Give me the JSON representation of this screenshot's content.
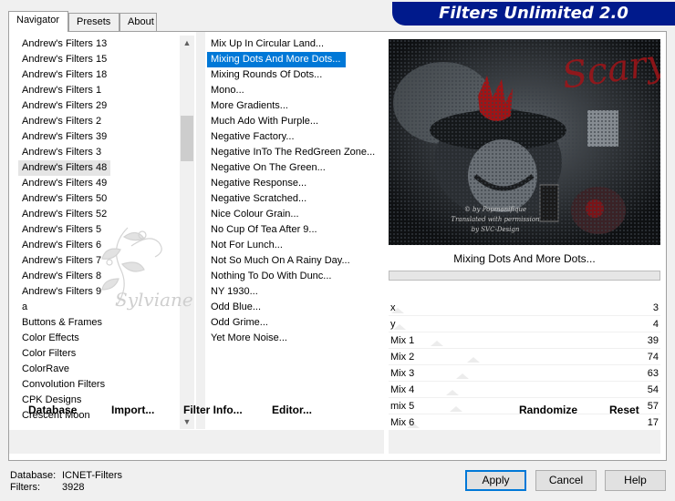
{
  "tabs": [
    "Navigator",
    "Presets",
    "About"
  ],
  "app_title": "Filters Unlimited 2.0",
  "categories": {
    "items": [
      "Andrew's Filters 13",
      "Andrew's Filters 15",
      "Andrew's Filters 18",
      "Andrew's Filters 1",
      "Andrew's Filters 29",
      "Andrew's Filters 2",
      "Andrew's Filters 39",
      "Andrew's Filters 3",
      "Andrew's Filters 48",
      "Andrew's Filters 49",
      "Andrew's Filters 50",
      "Andrew's Filters 52",
      "Andrew's Filters 5",
      "Andrew's Filters 6",
      "Andrew's Filters 7",
      "Andrew's Filters 8",
      "Andrew's Filters 9",
      "a",
      "Buttons & Frames",
      "Color Effects",
      "Color Filters",
      "ColorRave",
      "Convolution Filters",
      "CPK Designs",
      "Crescent Moon"
    ],
    "selected": "Andrew's Filters 48"
  },
  "filters": {
    "items": [
      "Mix Up In Circular Land...",
      "Mixing Dots And More Dots...",
      "Mixing Rounds Of Dots...",
      "Mono...",
      "More Gradients...",
      "Much Ado With Purple...",
      "Negative Factory...",
      "Negative InTo The RedGreen Zone...",
      "Negative On The Green...",
      "Negative Response...",
      "Negative Scratched...",
      "Nice Colour Grain...",
      "No Cup Of Tea After 9...",
      "Not For Lunch...",
      "Not So Much On A Rainy Day...",
      "Nothing To Do With Dunc...",
      "NY 1930...",
      "Odd Blue...",
      "Odd Grime...",
      "Yet More Noise..."
    ],
    "selected": "Mixing Dots And More Dots..."
  },
  "left_buttons": {
    "database": "Database",
    "import": "Import...",
    "filter_info": "Filter Info...",
    "editor": "Editor..."
  },
  "preview": {
    "filter_name": "Mixing Dots And More Dots...",
    "art_title": "Scary",
    "credit_1": "© by Popmanifique",
    "credit_2": "Translated with permission",
    "credit_3": "by SVC-Design"
  },
  "params": [
    {
      "name": "x",
      "value": "3",
      "level": 0.01
    },
    {
      "name": "y",
      "value": "4",
      "level": 0.016
    },
    {
      "name": "Mix 1",
      "value": "39",
      "level": 0.153
    },
    {
      "name": "Mix 2",
      "value": "74",
      "level": 0.29
    },
    {
      "name": "Mix 3",
      "value": "63",
      "level": 0.247
    },
    {
      "name": "Mix 4",
      "value": "54",
      "level": 0.212
    },
    {
      "name": "mix 5",
      "value": "57",
      "level": 0.224
    },
    {
      "name": "Mix 6",
      "value": "17",
      "level": 0.067
    }
  ],
  "right_buttons": {
    "randomize": "Randomize",
    "reset": "Reset"
  },
  "status": {
    "database_label": "Database:",
    "database_value": "ICNET-Filters",
    "filters_label": "Filters:",
    "filters_value": "3928"
  },
  "dialog_buttons": {
    "apply": "Apply",
    "cancel": "Cancel",
    "help": "Help"
  },
  "watermark_text": "Sylviane"
}
